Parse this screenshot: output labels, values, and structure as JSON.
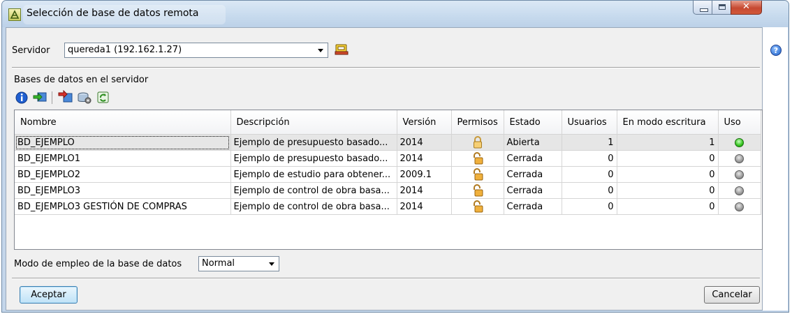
{
  "window": {
    "title": "Selección de base de datos remota"
  },
  "server": {
    "label": "Servidor",
    "value": "quereda1 (192.162.1.27)"
  },
  "databases": {
    "section_label": "Bases de datos en el servidor",
    "toolbar_icons": [
      "info-icon",
      "import-icon",
      "transfer-icon",
      "database-settings-icon",
      "refresh-icon"
    ],
    "columns": [
      "Nombre",
      "Descripción",
      "Versión",
      "Permisos",
      "Estado",
      "Usuarios",
      "En modo escritura",
      "Uso"
    ],
    "rows": [
      {
        "name": "BD_EJEMPLO",
        "description": "Ejemplo de presupuesto basado...",
        "version": "2014",
        "permission": "locked",
        "state": "Abierta",
        "users": "1",
        "write_mode": "1",
        "usage": "active",
        "selected": true
      },
      {
        "name": "BD_EJEMPLO1",
        "description": "Ejemplo de presupuesto basado...",
        "version": "2014",
        "permission": "unlocked",
        "state": "Cerrada",
        "users": "0",
        "write_mode": "0",
        "usage": "inactive",
        "selected": false
      },
      {
        "name": "BD_EJEMPLO2",
        "description": "Ejemplo de estudio para obtener...",
        "version": "2009.1",
        "permission": "unlocked",
        "state": "Cerrada",
        "users": "0",
        "write_mode": "0",
        "usage": "inactive",
        "selected": false
      },
      {
        "name": "BD_EJEMPLO3",
        "description": "Ejemplo de control de obra basa...",
        "version": "2014",
        "permission": "unlocked",
        "state": "Cerrada",
        "users": "0",
        "write_mode": "0",
        "usage": "inactive",
        "selected": false
      },
      {
        "name": "BD_EJEMPLO3 GESTIÓN DE COMPRAS",
        "description": "Ejemplo de control de obra basa...",
        "version": "2014",
        "permission": "unlocked",
        "state": "Cerrada",
        "users": "0",
        "write_mode": "0",
        "usage": "inactive",
        "selected": false
      }
    ]
  },
  "mode": {
    "label": "Modo de empleo de la base de datos",
    "value": "Normal"
  },
  "buttons": {
    "accept": "Aceptar",
    "cancel": "Cancelar"
  },
  "colors": {
    "active_led": "#35c41e",
    "inactive_led": "#9a9a9a",
    "selection": "#e6e6e6"
  }
}
